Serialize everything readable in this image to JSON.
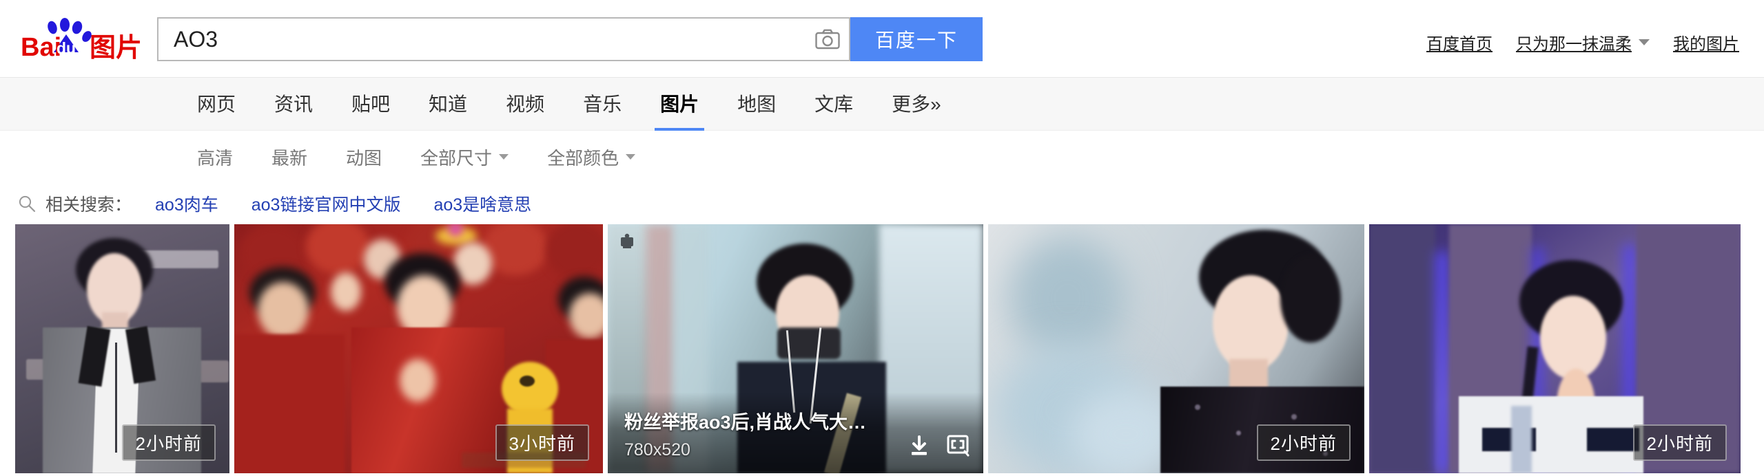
{
  "brand": {
    "name": "Bai",
    "name_cn": "图片",
    "logo_alt": "baidu-paw-logo"
  },
  "search": {
    "query": "AO3",
    "placeholder": "",
    "camera_icon": "camera-icon",
    "button_label": "百度一下"
  },
  "top_links": [
    {
      "label": "百度首页",
      "name": "baidu-home"
    },
    {
      "label": "只为那一抹温柔",
      "name": "user-account",
      "has_caret": true
    },
    {
      "label": "我的图片",
      "name": "my-images"
    }
  ],
  "nav_tabs": [
    {
      "label": "网页",
      "active": false
    },
    {
      "label": "资讯",
      "active": false
    },
    {
      "label": "贴吧",
      "active": false
    },
    {
      "label": "知道",
      "active": false
    },
    {
      "label": "视频",
      "active": false
    },
    {
      "label": "音乐",
      "active": false
    },
    {
      "label": "图片",
      "active": true
    },
    {
      "label": "地图",
      "active": false
    },
    {
      "label": "文库",
      "active": false
    },
    {
      "label": "更多»",
      "active": false
    }
  ],
  "filters": [
    {
      "label": "高清",
      "dropdown": false
    },
    {
      "label": "最新",
      "dropdown": false
    },
    {
      "label": "动图",
      "dropdown": false
    },
    {
      "label": "全部尺寸",
      "dropdown": true
    },
    {
      "label": "全部颜色",
      "dropdown": true
    }
  ],
  "related": {
    "icon": "search-icon",
    "label": "相关搜索：",
    "links": [
      "ao3肉车",
      "ao3链接官网中文版",
      "ao3是啥意思"
    ]
  },
  "results": [
    {
      "id": "result-1",
      "time_badge": "2小时前",
      "hovered": false,
      "alt": "man in gray checked blazer at COSMO red carpet event"
    },
    {
      "id": "result-2",
      "time_badge": "3小时前",
      "hovered": false,
      "alt": "group in red festive outfits at a gala show with yellow mascot"
    },
    {
      "id": "result-3",
      "time_badge": "",
      "hovered": true,
      "title": "粉丝举报ao3后,肖战人气大…",
      "dimensions": "780x520",
      "download_icon": "download-icon",
      "similar_icon": "similar-image-icon",
      "pin_icon": "pin-icon",
      "alt": "man with dark hair and face mask outdoors"
    },
    {
      "id": "result-4",
      "time_badge": "2小时前",
      "hovered": false,
      "alt": "man in black sequined jacket against pale blue backdrop"
    },
    {
      "id": "result-5",
      "time_badge": "2小时前",
      "hovered": false,
      "alt": "man in white and navy knit top with hands clasped on blue stage"
    }
  ],
  "colors": {
    "accent_blue": "#4e87f5",
    "link_blue": "#2440b3",
    "logo_red": "#e10602",
    "logo_blue": "#2319dc",
    "nav_bg": "#f7f7f7"
  }
}
